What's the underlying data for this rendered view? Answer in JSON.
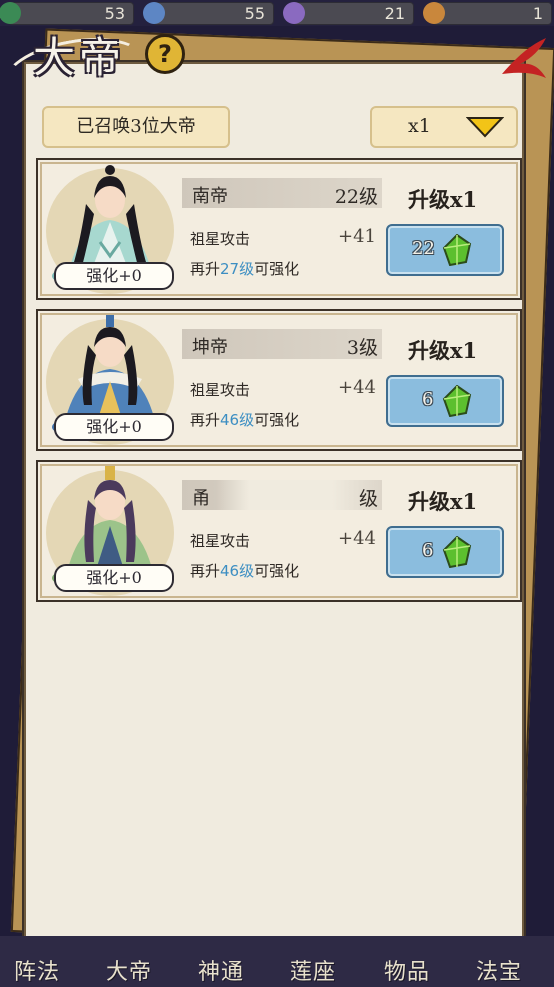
{
  "resources": [
    {
      "value": "53",
      "color": "#3b8a55"
    },
    {
      "value": "55",
      "color": "#5d86c4"
    },
    {
      "value": "21",
      "color": "#8a6ac0"
    },
    {
      "value": "1",
      "color": "#c9873c"
    }
  ],
  "header": {
    "title": "大帝",
    "summoned": "已召唤3位大帝",
    "multiplier": "x1"
  },
  "cards": [
    {
      "name": "南帝",
      "level": "22级",
      "enhance": "强化+0",
      "stat_label": "祖星攻击",
      "stat_value": "+41",
      "req_prefix": "再升",
      "req_level": "27级",
      "req_suffix": "可强化",
      "upgrade_label": "升级x1",
      "cost": "22"
    },
    {
      "name": "坤帝",
      "level": "3级",
      "enhance": "强化+0",
      "stat_label": "祖星攻击",
      "stat_value": "+44",
      "req_prefix": "再升",
      "req_level": "46级",
      "req_suffix": "可强化",
      "upgrade_label": "升级x1",
      "cost": "6"
    },
    {
      "name": "甬",
      "level": "级",
      "enhance": "强化+0",
      "stat_label": "祖星攻击",
      "stat_value": "+44",
      "req_prefix": "再升",
      "req_level": "46级",
      "req_suffix": "可强化",
      "upgrade_label": "升级x1",
      "cost": "6"
    }
  ],
  "tabs": [
    "阵法",
    "大帝",
    "神通",
    "莲座",
    "物品",
    "法宝"
  ],
  "colors": {
    "accent_blue": "#3c8ec2",
    "button_blue": "#8bbdde",
    "gem_green": "#5cbf2e"
  }
}
